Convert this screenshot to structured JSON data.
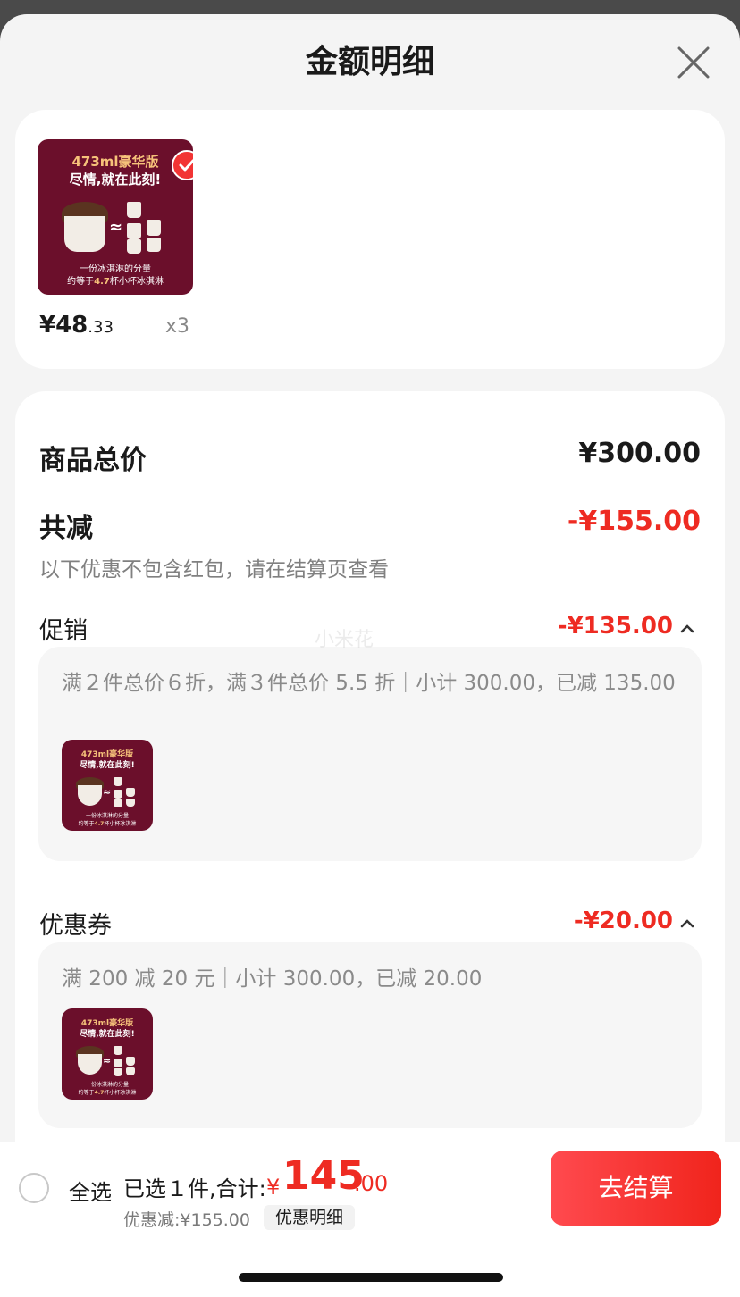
{
  "sheet": {
    "title": "金额明细"
  },
  "product": {
    "image": {
      "line1": "473ml豪华版",
      "line2": "尽情,就在此刻!",
      "approx": "≈",
      "caption1": "一份冰淇淋的分量",
      "caption2_prefix": "约等于",
      "caption2_num": "4.7",
      "caption2_suffix": "杯小杯冰淇淋"
    },
    "price_int": "¥48",
    "price_dec": ".33",
    "qty": "x3"
  },
  "detail": {
    "total_label": "商品总价",
    "total_value": "¥300.00",
    "reduce_label": "共减",
    "reduce_value": "-¥155.00",
    "note": "以下优惠不包含红包，请在结算页查看",
    "promo": {
      "label": "促销",
      "value": "-¥135.00",
      "desc": "满２件总价６折，满３件总价 5.5 折｜小计 300.00，已减 135.00"
    },
    "coupon": {
      "label": "优惠券",
      "value": "-¥20.00",
      "desc": "满 200 减 20 元｜小计 300.00，已减 20.00"
    },
    "watermark": "小米花"
  },
  "bottom": {
    "select_all": "全选",
    "summary": "已选１件,合计:",
    "total_sym": "¥",
    "total_int": "145",
    "total_dec": ".00",
    "discount": "优惠减:¥155.00",
    "detail_chip": "优惠明细",
    "checkout": "去结算"
  },
  "colors": {
    "accent": "#ee2b22",
    "product_bg": "#6b0f2b"
  }
}
